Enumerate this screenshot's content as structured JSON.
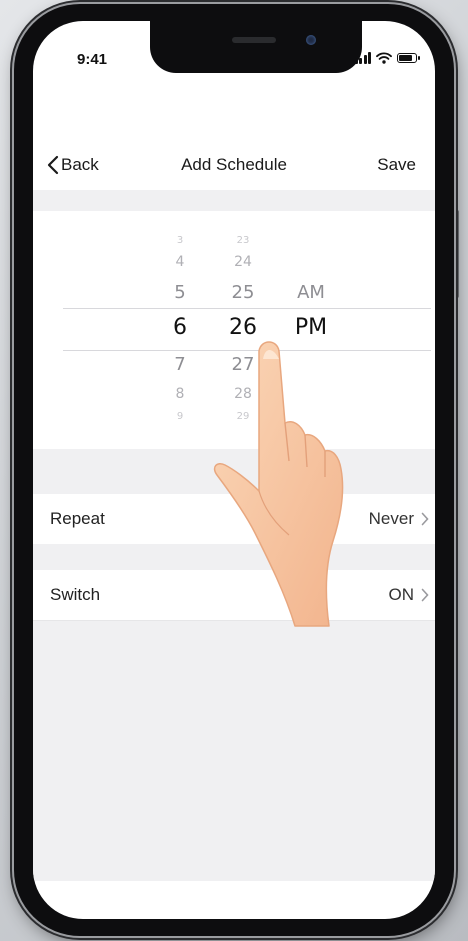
{
  "status_bar": {
    "time": "9:41"
  },
  "nav": {
    "back_label": "Back",
    "title": "Add Schedule",
    "save_label": "Save"
  },
  "picker": {
    "hours": [
      "3",
      "4",
      "5",
      "6",
      "7",
      "8",
      "9"
    ],
    "minutes": [
      "23",
      "24",
      "25",
      "26",
      "27",
      "28",
      "29"
    ],
    "meridiem": [
      "AM",
      "PM"
    ],
    "selected": {
      "hour": "6",
      "minute": "26",
      "meridiem": "PM"
    }
  },
  "rows": [
    {
      "label": "Repeat",
      "value": "Never"
    },
    {
      "label": "Switch",
      "value": "ON"
    }
  ],
  "colors": {
    "page_bg": "#f0f0f2",
    "text": "#1a1a1a",
    "skin": "#f7c9a4"
  },
  "icons": [
    "chevron-left-icon",
    "chevron-right-icon",
    "signal-icon",
    "wifi-icon",
    "battery-icon",
    "pointing-hand-icon"
  ]
}
